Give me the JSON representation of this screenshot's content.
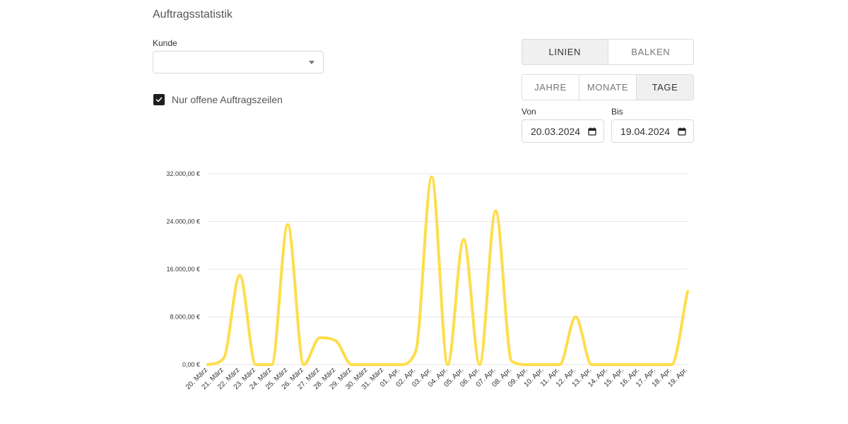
{
  "page": {
    "title": "Auftragsstatistik"
  },
  "filters": {
    "customer_label": "Kunde",
    "customer_value": "",
    "open_lines_checked": true,
    "open_lines_label": "Nur offene Auftragszeilen"
  },
  "chart_type_toggle": {
    "lines": "LINIEN",
    "bars": "BALKEN",
    "selected": "LINIEN"
  },
  "period_toggle": {
    "years": "JAHRE",
    "months": "MONATE",
    "days": "TAGE",
    "selected": "TAGE"
  },
  "date_range": {
    "from_label": "Von",
    "from_value": "20.03.2024",
    "to_label": "Bis",
    "to_value": "19.04.2024"
  },
  "colors": {
    "line": "#FFDD4A",
    "grid": "#e6e6e6",
    "active_button": "#f0f0f0"
  },
  "chart_data": {
    "type": "line",
    "title": "",
    "xlabel": "",
    "ylabel": "",
    "ylim": [
      0,
      32000
    ],
    "y_ticks": [
      "0,00 €",
      "8.000,00 €",
      "16.000,00 €",
      "24.000,00 €",
      "32.000,00 €"
    ],
    "categories": [
      "20. März",
      "21. März",
      "22. März",
      "23. März",
      "24. März",
      "25. März",
      "26. März",
      "27. März",
      "28. März",
      "29. März",
      "30. März",
      "31. März",
      "01. Apr.",
      "02. Apr.",
      "03. Apr.",
      "04. Apr.",
      "05. Apr.",
      "06. Apr.",
      "07. Apr.",
      "08. Apr.",
      "09. Apr.",
      "10. Apr.",
      "11. Apr.",
      "12. Apr.",
      "13. Apr.",
      "14. Apr.",
      "15. Apr.",
      "16. Apr.",
      "17. Apr.",
      "18. Apr.",
      "19. Apr."
    ],
    "values": [
      0,
      1100,
      15000,
      0,
      0,
      23500,
      0,
      4500,
      4000,
      0,
      0,
      0,
      0,
      2200,
      31500,
      0,
      21000,
      0,
      25800,
      600,
      0,
      0,
      0,
      8000,
      0,
      0,
      0,
      0,
      0,
      0,
      12300
    ],
    "grid": true,
    "legend": "none"
  }
}
